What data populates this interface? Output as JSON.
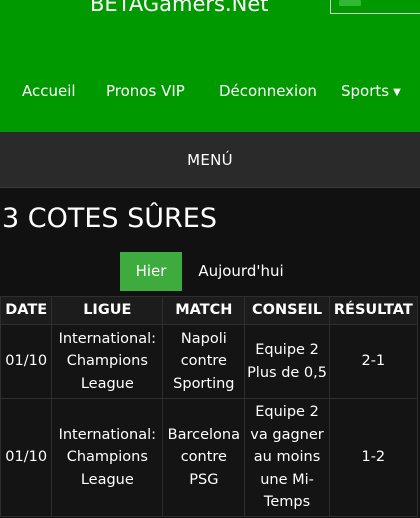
{
  "header": {
    "site_title": "BETAGamers.Net",
    "background_color": "#009a00"
  },
  "nav": {
    "items": [
      {
        "label": "Accueil"
      },
      {
        "label": "Pronos VIP"
      },
      {
        "label": "Déconnexion"
      },
      {
        "label": "Sports"
      }
    ],
    "sports_caret_icon": "caret-down-icon"
  },
  "menu": {
    "label": "MENÚ"
  },
  "section": {
    "title": "3 COTES SÛRES"
  },
  "tabs": [
    {
      "label": "Hier",
      "active": true,
      "active_color": "#3dab3d"
    },
    {
      "label": "Aujourd'hui",
      "active": false
    }
  ],
  "table": {
    "headers": [
      "DATE",
      "LIGUE",
      "MATCH",
      "CONSEIL",
      "RÉSULTAT"
    ],
    "rows": [
      {
        "date": "01/10",
        "ligue": "International: Champions League",
        "match": "Napoli contre Sporting",
        "conseil": "Equipe 2 Plus de 0,5",
        "resultat": "2-1"
      },
      {
        "date": "01/10",
        "ligue": "International: Champions League",
        "match": "Barcelona contre PSG",
        "conseil": "Equipe 2 va gagner au moins une Mi-Temps",
        "resultat": "1-2"
      }
    ]
  }
}
